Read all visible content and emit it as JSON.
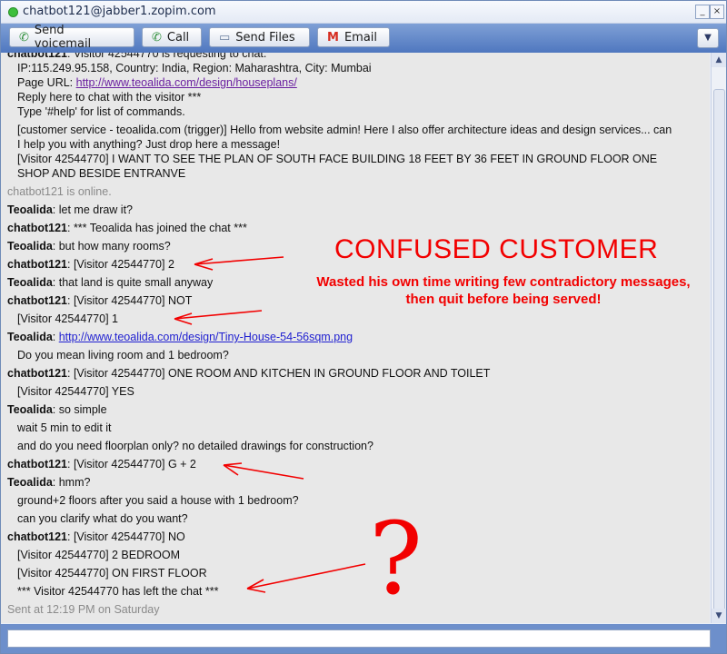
{
  "window": {
    "title": "chatbot121@jabber1.zopim.com"
  },
  "toolbar": {
    "voicemail_label": "Send voicemail",
    "call_label": "Call",
    "files_label": "Send Files",
    "email_label": "Email"
  },
  "chat": {
    "line0_name": "chatbot121",
    "line0_text": ": Visitor 42544770 is requesting to chat.",
    "ip_info": "IP:115.249.95.158, Country: India, Region: Maharashtra, City: Mumbai",
    "page_url_label": "Page URL: ",
    "page_url": "http://www.teoalida.com/design/houseplans/",
    "reply_hint": "Reply here to chat with the visitor ***",
    "help_hint": "Type '#help' for list of commands.",
    "trigger_1": "[customer service - teoalida.com (trigger)] Hello from website admin! Here I also offer architecture ideas and design services... can",
    "trigger_2": "I help you with anything? Just drop here a message!",
    "visitor_msg_1": "[Visitor 42544770] I WANT TO SEE THE PLAN OF SOUTH FACE BUILDING 18 FEET BY 36 FEET IN GROUND FLOOR ONE",
    "visitor_msg_2": "SHOP AND BESIDE ENTRANVE",
    "online_status": "chatbot121 is online.",
    "name_teo": "Teoalida",
    "name_bot": "chatbot121",
    "m1": ": let me draw it?",
    "m2": ": *** Teoalida has joined the chat ***",
    "m3": ": but how many rooms?",
    "m4": ": [Visitor 42544770] 2",
    "m5": ": that land is quite small anyway",
    "m6": ": [Visitor 42544770] NOT",
    "m7": "[Visitor 42544770] 1",
    "m8_link": "http://www.teoalida.com/design/Tiny-House-54-56sqm.png",
    "m9": "Do you mean living room and 1 bedroom?",
    "m10": ": [Visitor 42544770] ONE ROOM AND KITCHEN IN GROUND FLOOR AND TOILET",
    "m11": "[Visitor 42544770] YES",
    "m12": ": so simple",
    "m13": "wait 5 min to edit it",
    "m14": "and do you need floorplan only? no detailed drawings for construction?",
    "m15": ": [Visitor 42544770] G + 2",
    "m16": ": hmm?",
    "m17": "ground+2 floors after you said a house with 1 bedroom?",
    "m18": "can you clarify what do you want?",
    "m19": ": [Visitor 42544770] NO",
    "m20": "[Visitor 42544770] 2 BEDROOM",
    "m21": "[Visitor 42544770] ON FIRST FLOOR",
    "m22": "*** Visitor 42544770 has left the chat ***",
    "sent_at": "Sent at 12:19 PM on Saturday"
  },
  "annotation": {
    "headline": "CONFUSED CUSTOMER",
    "note_line1": "Wasted his own time writing few contradictory messages,",
    "note_line2": "then quit before being served!",
    "question_mark": "?",
    "color": "#f20000"
  },
  "icons": {
    "status": "online-status-icon",
    "voicemail": "phone-icon",
    "call": "phone-icon",
    "files": "folder-icon",
    "email": "gmail-icon",
    "menu": "chevron-down-icon"
  }
}
